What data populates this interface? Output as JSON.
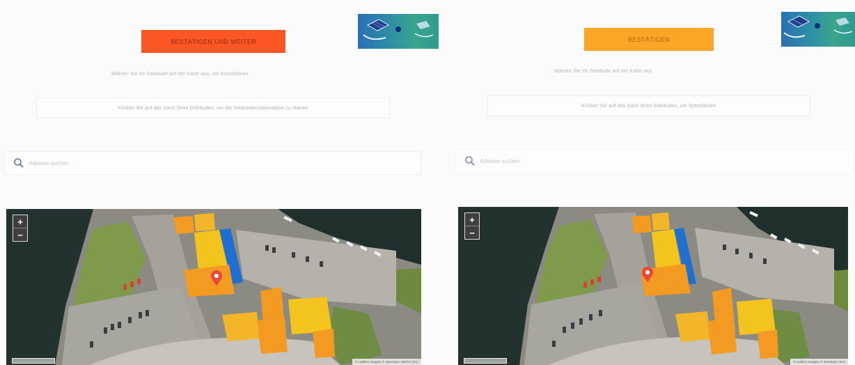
{
  "left": {
    "button_label": "BESTÄTIGEN UND WEITER",
    "button_color": "#fb5623",
    "info_line": "Wählen Sie Ihr Gebäude auf der Karte aus, um fortzufahren",
    "info_box": "Klicken Sie auf das Dach Ihres Gebäudes, um die Solarpotenzialanalyse zu starten",
    "search_placeholder": "Adresse suchen",
    "zoom_in": "+",
    "zoom_out": "−",
    "attribution": "© Leaflet | Imagery © swisstopo, WMTS | Esri"
  },
  "right": {
    "button_label": "BESTÄTIGEN",
    "button_color": "#fca526",
    "info_line": "Wählen Sie Ihr Gebäude auf der Karte aus",
    "info_box": "Klicken Sie auf das Dach Ihres Gebäudes, um fortzufahren",
    "search_placeholder": "Adresse suchen",
    "zoom_in": "+",
    "zoom_out": "−",
    "attribution": "© Leaflet | Imagery © swisstopo | Esri"
  },
  "icons": {
    "search": "search-icon",
    "map_marker": "map-marker-icon",
    "solar_thumbnail": "solar-panel-thumbnail"
  },
  "colors": {
    "roof_yellow": "#f3c41d",
    "roof_orange": "#f29a22",
    "roof_blue": "#1f6fd0",
    "marker_red": "#e64a3b",
    "water": "#20342f"
  }
}
